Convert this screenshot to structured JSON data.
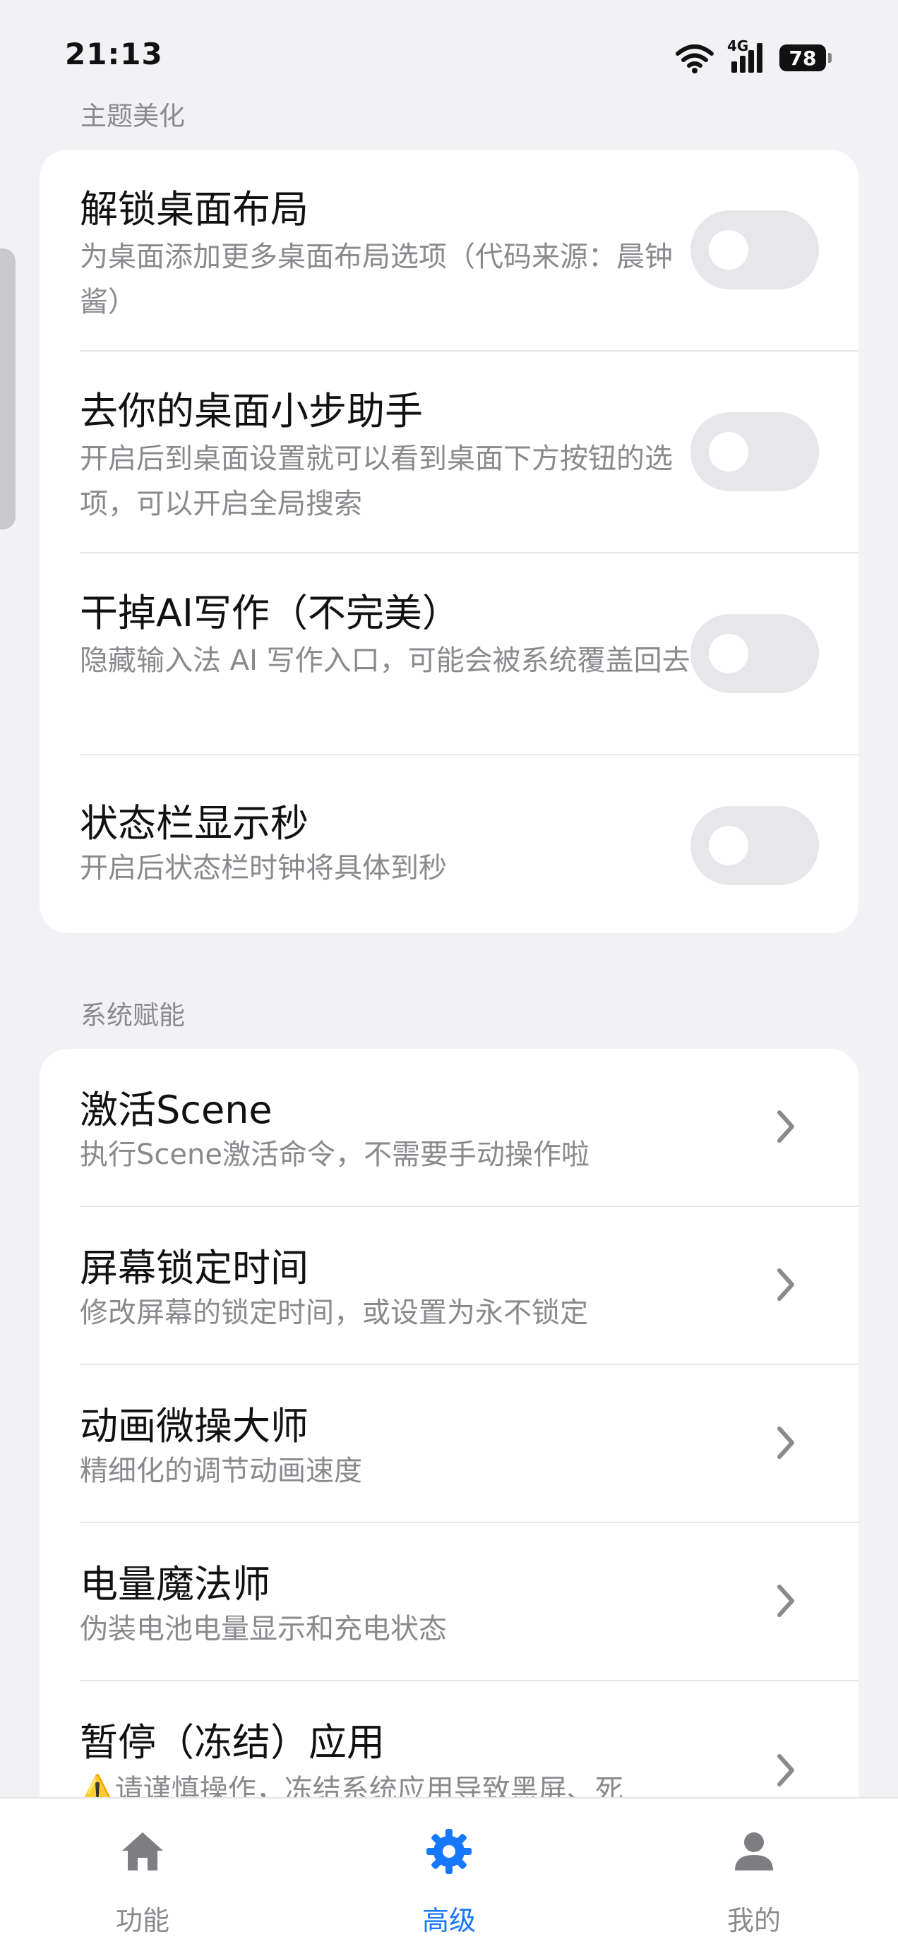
{
  "status": {
    "time": "21:13",
    "network": "4G",
    "battery": "78"
  },
  "theme_section": {
    "title": "主题美化",
    "items": [
      {
        "title": "解锁桌面布局",
        "desc": "为桌面添加更多桌面布局选项（代码来源：晨钟酱）",
        "enabled": false
      },
      {
        "title": "去你的桌面小步助手",
        "desc": "开启后到桌面设置就可以看到桌面下方按钮的选项，可以开启全局搜索",
        "enabled": false
      },
      {
        "title": "干掉AI写作（不完美）",
        "desc": "隐藏输入法 AI 写作入口，可能会被系统覆盖回去",
        "enabled": false
      },
      {
        "title": "状态栏显示秒",
        "desc": "开启后状态栏时钟将具体到秒",
        "enabled": false
      }
    ]
  },
  "system_section": {
    "title": "系统赋能",
    "items": [
      {
        "title": "激活Scene",
        "desc": "执行Scene激活命令，不需要手动操作啦"
      },
      {
        "title": "屏幕锁定时间",
        "desc": "修改屏幕的锁定时间，或设置为永不锁定"
      },
      {
        "title": "动画微操大师",
        "desc": "精细化的调节动画速度"
      },
      {
        "title": "电量魔法师",
        "desc": "伪装电池电量显示和充电状态"
      },
      {
        "title": "暂停（冻结）应用",
        "desc": "⚠️请谨慎操作，冻结系统应用导致黑屏、死"
      }
    ]
  },
  "tabs": [
    {
      "label": "功能",
      "icon": "home-icon",
      "active": false
    },
    {
      "label": "高级",
      "icon": "gear-icon",
      "active": true
    },
    {
      "label": "我的",
      "icon": "person-icon",
      "active": false
    }
  ],
  "colors": {
    "accent": "#1677ff",
    "background": "#f2f2f4",
    "muted": "#8a8a8e"
  }
}
